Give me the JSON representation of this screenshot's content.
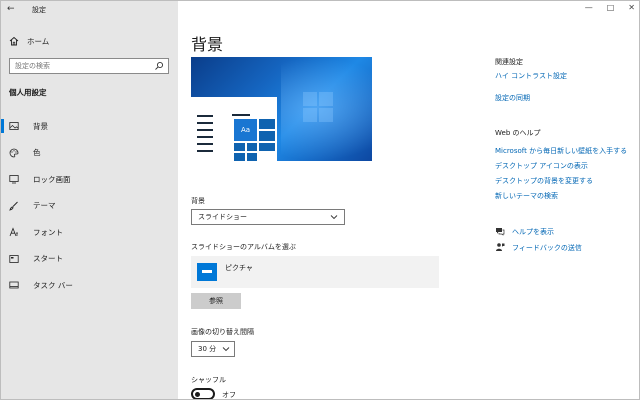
{
  "window": {
    "app_title": "設定",
    "back_icon": "back-arrow-icon",
    "controls": [
      "—",
      "□",
      "✕"
    ]
  },
  "sidebar": {
    "home_label": "ホーム",
    "search_placeholder": "設定の検索",
    "section_title": "個人用設定",
    "items": [
      {
        "label": "背景",
        "icon": "picture-icon",
        "active": true
      },
      {
        "label": "色",
        "icon": "palette-icon",
        "active": false
      },
      {
        "label": "ロック画面",
        "icon": "lock-screen-icon",
        "active": false
      },
      {
        "label": "テーマ",
        "icon": "brush-icon",
        "active": false
      },
      {
        "label": "フォント",
        "icon": "font-icon",
        "active": false
      },
      {
        "label": "スタート",
        "icon": "start-icon",
        "active": false
      },
      {
        "label": "タスク バー",
        "icon": "taskbar-icon",
        "active": false
      }
    ]
  },
  "main": {
    "page_title": "背景",
    "preview_tile_text": "Aa",
    "background_label": "背景",
    "background_value": "スライドショー",
    "album_label": "スライドショーのアルバムを選ぶ",
    "album_item": "ピクチャ",
    "browse_button": "参照",
    "interval_label": "画像の切り替え間隔",
    "interval_value": "30 分",
    "shuffle_label": "シャッフル",
    "shuffle_state": "オフ"
  },
  "right": {
    "related_heading": "関連設定",
    "related_links": [
      "ハイ コントラスト設定",
      "設定の同期"
    ],
    "help_heading": "Web のヘルプ",
    "help_links": [
      "Microsoft から毎日新しい壁紙を入手する",
      "デスクトップ アイコンの表示",
      "デスクトップの背景を変更する",
      "新しいテーマの検索"
    ],
    "get_help": "ヘルプを表示",
    "feedback": "フィードバックの送信"
  },
  "colors": {
    "accent": "#0078d7",
    "link": "#0066b4",
    "sidebar_bg": "#e6e6e6"
  }
}
